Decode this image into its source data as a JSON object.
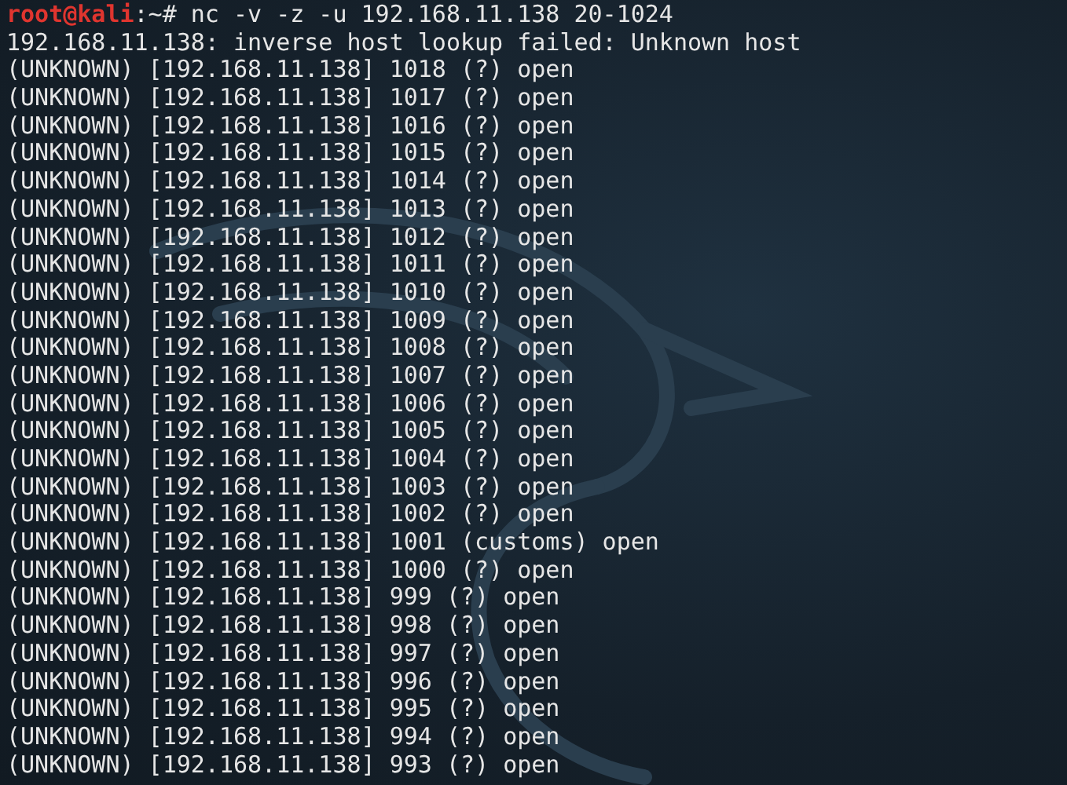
{
  "terminal": {
    "prompt": {
      "user": "root@kali",
      "path": ":~#",
      "command": "nc -v -z -u 192.168.11.138 20-1024"
    },
    "output": [
      "192.168.11.138: inverse host lookup failed: Unknown host",
      "(UNKNOWN) [192.168.11.138] 1018 (?) open",
      "(UNKNOWN) [192.168.11.138] 1017 (?) open",
      "(UNKNOWN) [192.168.11.138] 1016 (?) open",
      "(UNKNOWN) [192.168.11.138] 1015 (?) open",
      "(UNKNOWN) [192.168.11.138] 1014 (?) open",
      "(UNKNOWN) [192.168.11.138] 1013 (?) open",
      "(UNKNOWN) [192.168.11.138] 1012 (?) open",
      "(UNKNOWN) [192.168.11.138] 1011 (?) open",
      "(UNKNOWN) [192.168.11.138] 1010 (?) open",
      "(UNKNOWN) [192.168.11.138] 1009 (?) open",
      "(UNKNOWN) [192.168.11.138] 1008 (?) open",
      "(UNKNOWN) [192.168.11.138] 1007 (?) open",
      "(UNKNOWN) [192.168.11.138] 1006 (?) open",
      "(UNKNOWN) [192.168.11.138] 1005 (?) open",
      "(UNKNOWN) [192.168.11.138] 1004 (?) open",
      "(UNKNOWN) [192.168.11.138] 1003 (?) open",
      "(UNKNOWN) [192.168.11.138] 1002 (?) open",
      "(UNKNOWN) [192.168.11.138] 1001 (customs) open",
      "(UNKNOWN) [192.168.11.138] 1000 (?) open",
      "(UNKNOWN) [192.168.11.138] 999 (?) open",
      "(UNKNOWN) [192.168.11.138] 998 (?) open",
      "(UNKNOWN) [192.168.11.138] 997 (?) open",
      "(UNKNOWN) [192.168.11.138] 996 (?) open",
      "(UNKNOWN) [192.168.11.138] 995 (?) open",
      "(UNKNOWN) [192.168.11.138] 994 (?) open",
      "(UNKNOWN) [192.168.11.138] 993 (?) open"
    ]
  }
}
